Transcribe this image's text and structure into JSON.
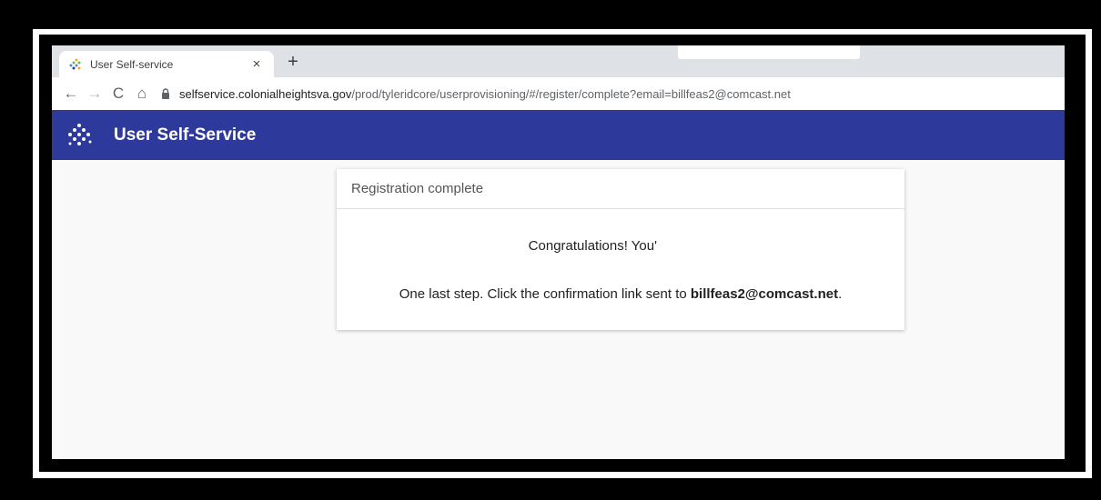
{
  "tab": {
    "title": "User Self-service",
    "close": "×",
    "new_tab": "+"
  },
  "nav": {
    "back": "←",
    "forward": "→",
    "reload": "C",
    "home": "⌂"
  },
  "address": {
    "host": "selfservice.colonialheightsva.gov",
    "path": "/prod/tyleridcore/userprovisioning/#/register/complete?email=billfeas2@comcast.net"
  },
  "app": {
    "title": "User Self-Service"
  },
  "card": {
    "header": "Registration complete",
    "congrats": "Congratulations! You're",
    "instruction_prefix": "One last step. Click the confirmation link sent to ",
    "email": "billfeas2@comcast.net",
    "instruction_suffix": "."
  },
  "colors": {
    "header_bg": "#2d3a9b",
    "page_bg": "#f9f9f9"
  },
  "icons": {
    "favicon": "tyler-logo-icon",
    "lock": "lock-icon",
    "app_logo": "tyler-logo-icon"
  }
}
